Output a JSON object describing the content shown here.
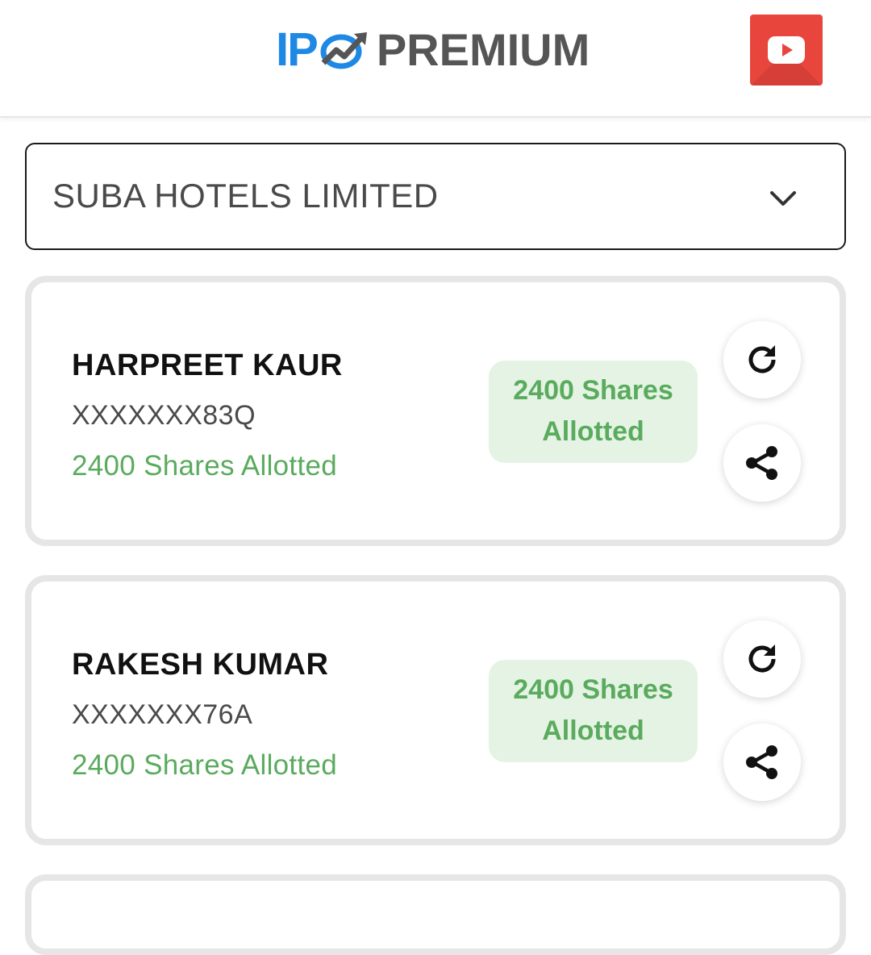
{
  "header": {
    "logo_ip": "IP",
    "logo_word": "PREMIUM",
    "logo_ip_color": "#1e88e5",
    "logo_word_color": "#555555",
    "youtube_icon": "youtube-icon",
    "youtube_color": "#e8453c"
  },
  "ipo_select": {
    "selected": "SUBA HOTELS LIMITED",
    "icon": "chevron-down-icon"
  },
  "results": [
    {
      "name": "HARPREET KAUR",
      "pan": "XXXXXXX83Q",
      "status": "2400 Shares Allotted",
      "badge_line1": "2400 Shares",
      "badge_line2": "Allotted",
      "refresh_icon": "refresh-icon",
      "share_icon": "share-icon"
    },
    {
      "name": "RAKESH KUMAR",
      "pan": "XXXXXXX76A",
      "status": "2400 Shares Allotted",
      "badge_line1": "2400 Shares",
      "badge_line2": "Allotted",
      "refresh_icon": "refresh-icon",
      "share_icon": "share-icon"
    }
  ],
  "colors": {
    "allotted_green": "#5aab5e",
    "badge_bg": "#e5f3e4",
    "card_border": "#e6e6e6"
  }
}
